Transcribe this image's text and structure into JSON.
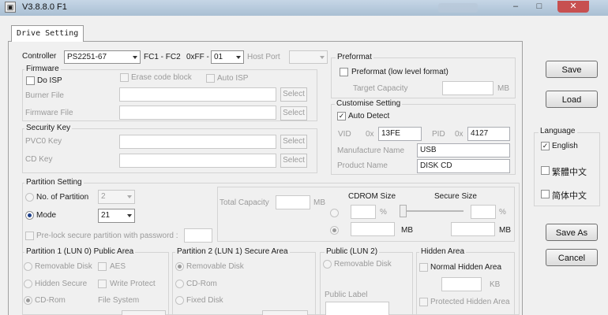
{
  "window": {
    "title": "V3.8.8.0 F1",
    "min": "–",
    "max": "□",
    "close": "✕"
  },
  "tabs": [
    {
      "label": "Drive Setting"
    }
  ],
  "controller": {
    "label": "Controller",
    "model": "PS2251-67",
    "fc_label": "FC1 - FC2",
    "fc_value": "0xFF -",
    "fc_select": "01",
    "host_port_label": "Host Port",
    "host_port_value": ""
  },
  "firmware": {
    "title": "Firmware",
    "do_isp": "Do ISP",
    "erase": "Erase code block",
    "auto_isp": "Auto ISP",
    "burner_label": "Burner File",
    "firmware_label": "Firmware File",
    "select": "Select"
  },
  "security": {
    "title": "Security Key",
    "pvco_label": "PVC0 Key",
    "cd_label": "CD Key",
    "select": "Select"
  },
  "partition": {
    "title": "Partition Setting",
    "no_label": "No. of Partition",
    "no_value": "2",
    "mode_label": "Mode",
    "mode_value": "21",
    "preload": "Pre-lock secure partition with password :"
  },
  "capacity": {
    "total_label": "Total Capacity",
    "mb": "MB",
    "cdrom_label": "CDROM Size",
    "secure_label": "Secure Size",
    "pct": "%"
  },
  "preformat": {
    "title": "Preformat",
    "option": "Preformat (low level format)",
    "target_label": "Target Capacity",
    "mb": "MB"
  },
  "customise": {
    "title": "Customise Setting",
    "auto_detect": "Auto Detect",
    "vid_label": "VID",
    "hex": "0x",
    "vid": "13FE",
    "pid_label": "PID",
    "pid": "4127",
    "manu_label": "Manufacture Name",
    "manu": "USB",
    "prod_label": "Product Name",
    "prod": "DISK CD"
  },
  "lun0": {
    "title": "Partition 1 (LUN 0) Public Area",
    "removable": "Removable Disk",
    "aes": "AES",
    "hidden": "Hidden Secure",
    "write_protect": "Write Protect",
    "cdrom": "CD-Rom",
    "fs": "File System"
  },
  "lun1": {
    "title": "Partition 2 (LUN 1) Secure Area",
    "removable": "Removable Disk",
    "cdrom": "CD-Rom",
    "fixed": "Fixed Disk"
  },
  "lun2": {
    "title": "Public (LUN 2)",
    "removable": "Removable Disk",
    "label": "Public Label"
  },
  "hidden_area": {
    "title": "Hidden Area",
    "normal": "Normal Hidden Area",
    "kb": "KB",
    "protected": "Protected Hidden Area"
  },
  "buttons": {
    "save": "Save",
    "load": "Load",
    "save_as": "Save As",
    "cancel": "Cancel"
  },
  "language": {
    "title": "Language",
    "english": "English",
    "trad": "繁體中文",
    "simp": "简体中文"
  }
}
